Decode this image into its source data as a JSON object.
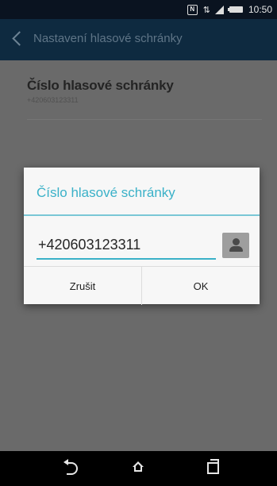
{
  "status_bar": {
    "time": "10:50",
    "icons": [
      "nfc-icon",
      "antenna-icon",
      "signal-icon",
      "battery-icon"
    ]
  },
  "action_bar": {
    "title": "Nastavení hlasové schránky",
    "back_icon": "chevron-left-icon"
  },
  "content": {
    "pref_title": "Číslo hlasové schránky",
    "pref_summary": "+420603123311"
  },
  "dialog": {
    "title": "Číslo hlasové schránky",
    "input_value": "+420603123311",
    "contact_icon": "contact-person-icon",
    "cancel_label": "Zrušit",
    "ok_label": "OK",
    "accent_color": "#3ab1c8"
  },
  "nav_bar": {
    "icons": [
      "back-icon",
      "home-icon",
      "recent-apps-icon"
    ]
  }
}
